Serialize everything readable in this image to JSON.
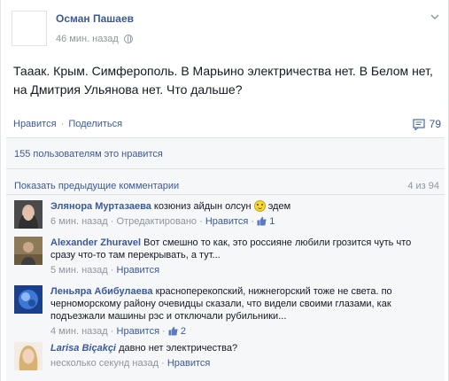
{
  "post": {
    "author": "Осман Пашаев",
    "time": "46 мин. назад",
    "text": "Тааак. Крым. Симферополь. В Марьино электричества нет. В Белом нет, на Дмитрия Ульянова нет. Что дальше?",
    "actions": {
      "like": "Нравится",
      "separator": "·",
      "share": "Поделиться"
    },
    "comments_count": "79"
  },
  "ufi": {
    "likes_text": "155 пользователям это нравится",
    "prev_comments": "Показать предыдущие комментарии",
    "pager": "4 из 94",
    "comments": [
      {
        "name": "Элянора Муртазаева",
        "text_before": "козюниз айдын олсун",
        "text_after": "эдем",
        "time": "6 мин. назад",
        "edited": "Отредактировано",
        "like": "Нравится",
        "likes": "1",
        "sep": "·"
      },
      {
        "name": "Alexander Zhuravel",
        "text": "Вот смешно то как, это россияне любили грозится чуть что сразу что-то там перекрывать, а тут...",
        "time": "5 мин. назад",
        "like": "Нравится",
        "sep": "·"
      },
      {
        "name": "Леньяра Абибулаева",
        "text": "красноперекопский, нижнегорский тоже не света. по черноморскому району очевидцы сказали, что видели своими глазами, как подъезжали машины рэс и отключали рубильники...",
        "time": "4 мин. назад",
        "like": "Нравится",
        "likes": "2",
        "sep": "·"
      },
      {
        "name": "Larisa Biçakçi",
        "text": "давно нет электричества?",
        "time": "несколько секунд назад",
        "like": "Нравится",
        "sep": "·"
      }
    ]
  },
  "icons": {
    "globe": "globe-icon",
    "chevron": "chevron-down-icon",
    "comments": "comment-bubble-icon",
    "thumb": "thumbs-up-icon",
    "smile": "smiley-emoticon-icon"
  },
  "colors": {
    "link": "#3b5998",
    "meta": "#90949c",
    "ufi_bg": "#f6f7f9"
  }
}
